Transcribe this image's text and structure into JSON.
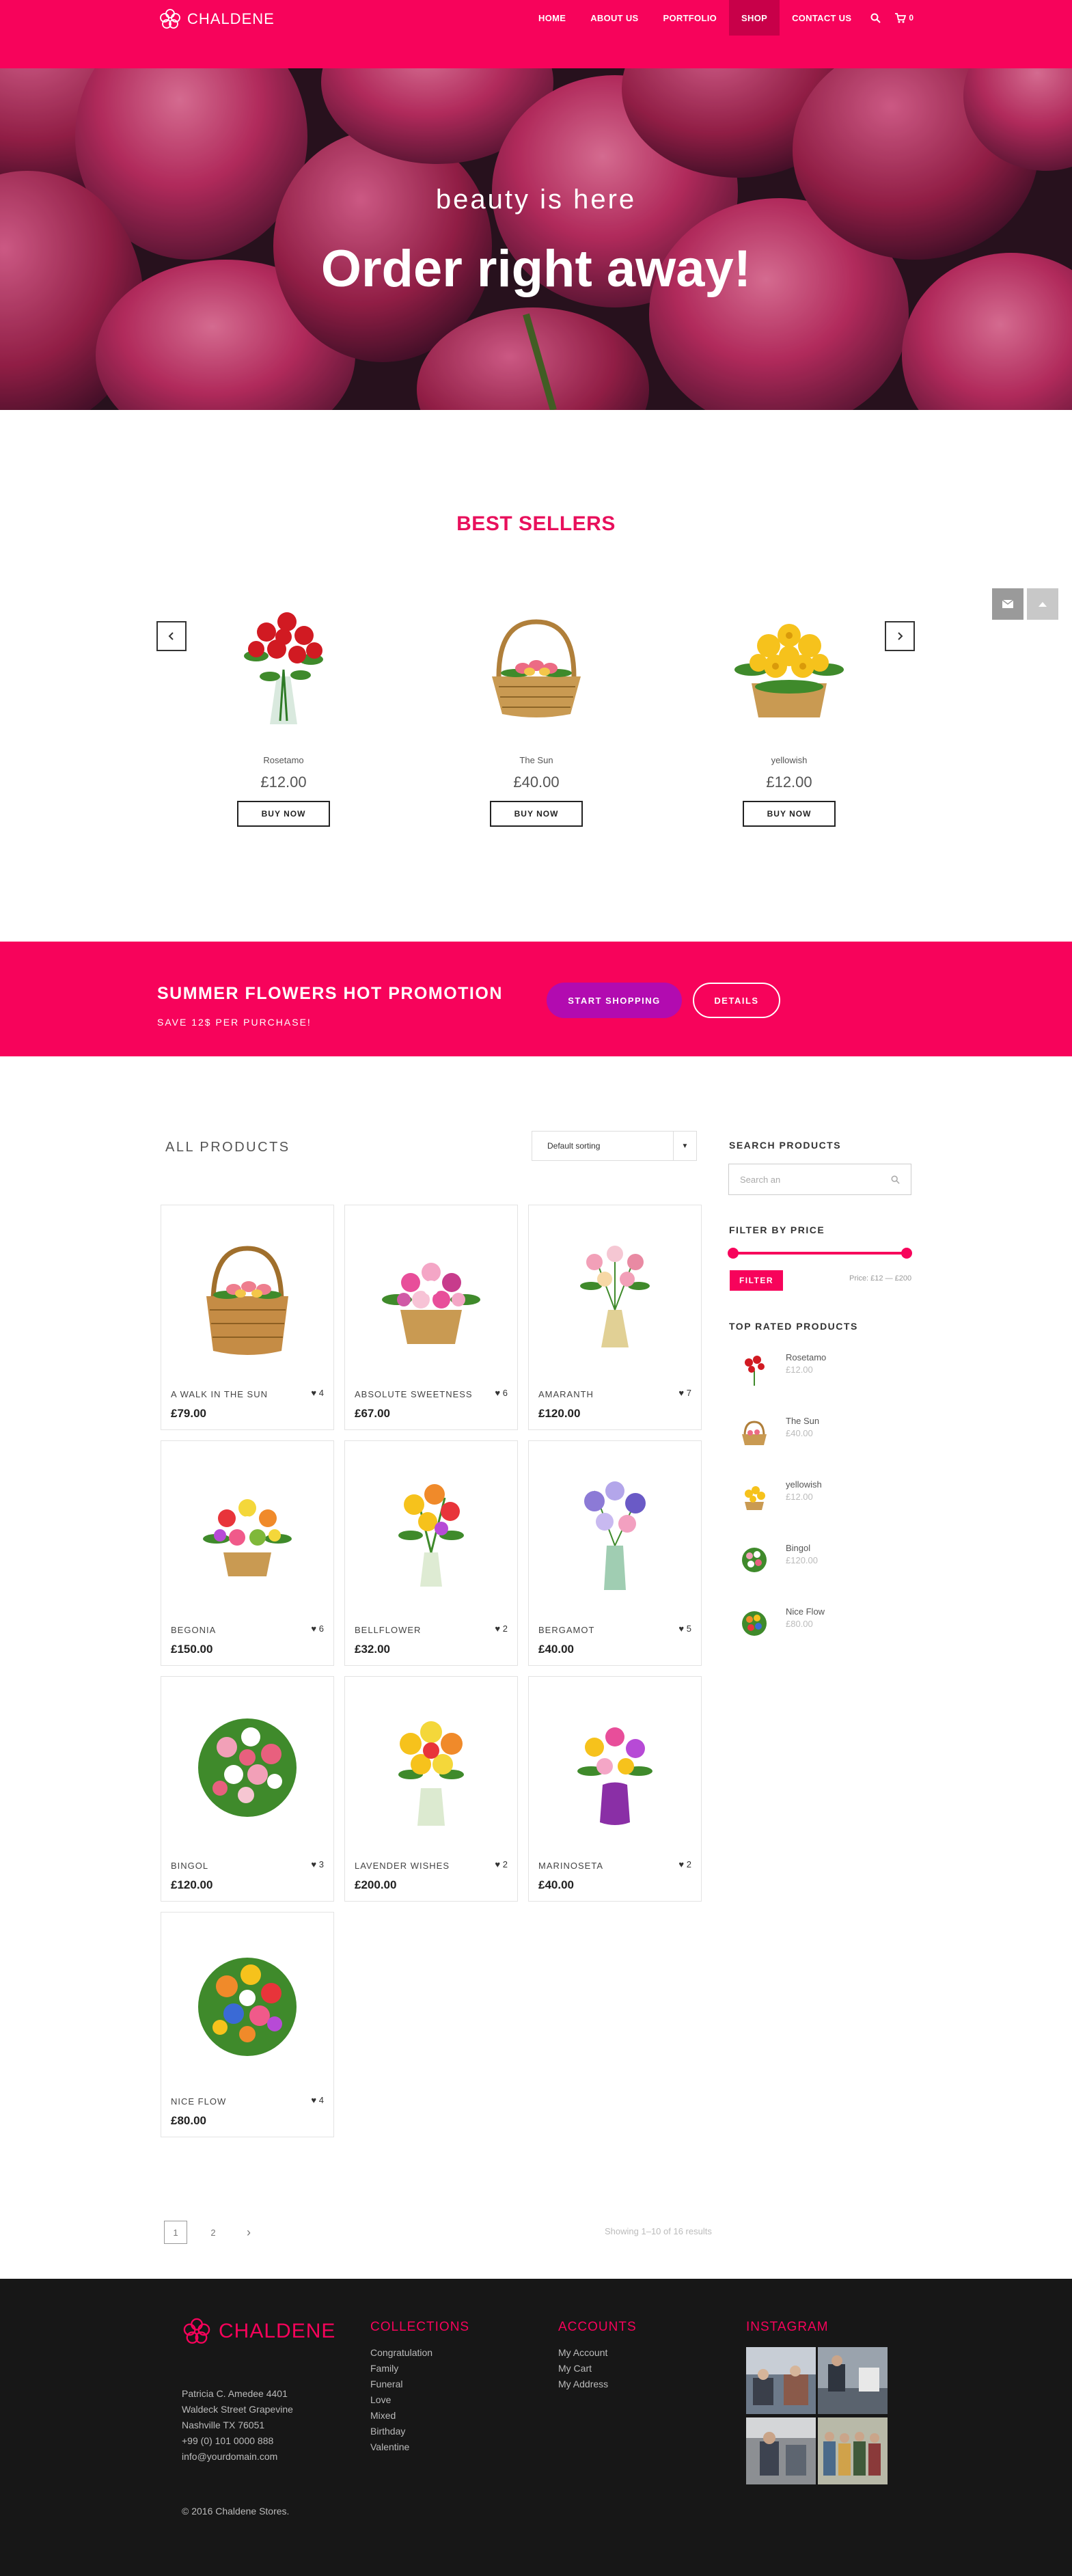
{
  "brand": {
    "name": "CHALDENE",
    "accent": "#f7035b"
  },
  "nav": {
    "items": [
      {
        "label": "HOME",
        "active": false
      },
      {
        "label": "ABOUT US",
        "active": false
      },
      {
        "label": "PORTFOLIO",
        "active": false
      },
      {
        "label": "SHOP",
        "active": true
      },
      {
        "label": "CONTACT US",
        "active": false
      }
    ],
    "search_icon": "search-icon",
    "cart_icon": "cart-icon",
    "cart_count": "0"
  },
  "hero": {
    "subtitle": "beauty is here",
    "title": "Order right away!"
  },
  "best_sellers": {
    "heading": "BEST SELLERS",
    "items": [
      {
        "name": "Rosetamo",
        "price": "£12.00",
        "button": "BUY NOW"
      },
      {
        "name": "The Sun",
        "price": "£40.00",
        "button": "BUY NOW"
      },
      {
        "name": "yellowish",
        "price": "£12.00",
        "button": "BUY NOW"
      }
    ],
    "prev_icon": "chevron-left-icon",
    "next_icon": "chevron-right-icon"
  },
  "side_buttons": {
    "mail_icon": "mail-icon",
    "up_icon": "arrow-up-icon"
  },
  "promo": {
    "title": "SUMMER FLOWERS HOT PROMOTION",
    "subtitle": "SAVE 12$ PER PURCHASE!",
    "start_button": "START SHOPPING",
    "details_button": "DETAILS"
  },
  "shop": {
    "heading": "ALL PRODUCTS",
    "sort_value": "Default sorting",
    "products": [
      {
        "name": "A WALK IN THE SUN",
        "price": "£79.00",
        "likes": "4"
      },
      {
        "name": "ABSOLUTE SWEETNESS",
        "price": "£67.00",
        "likes": "6"
      },
      {
        "name": "AMARANTH",
        "price": "£120.00",
        "likes": "7"
      },
      {
        "name": "BEGONIA",
        "price": "£150.00",
        "likes": "6"
      },
      {
        "name": "BELLFLOWER",
        "price": "£32.00",
        "likes": "2"
      },
      {
        "name": "BERGAMOT",
        "price": "£40.00",
        "likes": "5"
      },
      {
        "name": "BINGOL",
        "price": "£120.00",
        "likes": "3"
      },
      {
        "name": "LAVENDER WISHES",
        "price": "£200.00",
        "likes": "2"
      },
      {
        "name": "MARINOSETA",
        "price": "£40.00",
        "likes": "2"
      },
      {
        "name": "NICE FLOW",
        "price": "£80.00",
        "likes": "4"
      }
    ],
    "pagination": {
      "pages": [
        "1",
        "2"
      ],
      "current": "1",
      "next": "›"
    },
    "results": "Showing 1–10 of 16 results"
  },
  "sidebar": {
    "search_title": "SEARCH PRODUCTS",
    "search_placeholder": "Search an",
    "filter_title": "FILTER BY PRICE",
    "filter_button": "FILTER",
    "price_range": "Price: £12 — £200",
    "top_rated_title": "TOP RATED PRODUCTS",
    "top_rated": [
      {
        "name": "Rosetamo",
        "price": "£12.00"
      },
      {
        "name": "The Sun",
        "price": "£40.00"
      },
      {
        "name": "yellowish",
        "price": "£12.00"
      },
      {
        "name": "Bingol",
        "price": "£120.00"
      },
      {
        "name": "Nice Flow",
        "price": "£80.00"
      }
    ]
  },
  "footer": {
    "brand": "CHALDENE",
    "address": [
      "Patricia C. Amedee 4401",
      "Waldeck Street Grapevine",
      "Nashville TX 76051",
      "+99 (0) 101 0000 888",
      "info@yourdomain.com"
    ],
    "collections_title": "COLLECTIONS",
    "collections": [
      "Congratulation",
      "Family",
      "Funeral",
      "Love",
      "Mixed",
      "Birthday",
      "Valentine"
    ],
    "accounts_title": "ACCOUNTS",
    "accounts": [
      "My Account",
      "My Cart",
      "My Address"
    ],
    "instagram_title": "INSTAGRAM",
    "copyright": "© 2016 Chaldene Stores."
  }
}
